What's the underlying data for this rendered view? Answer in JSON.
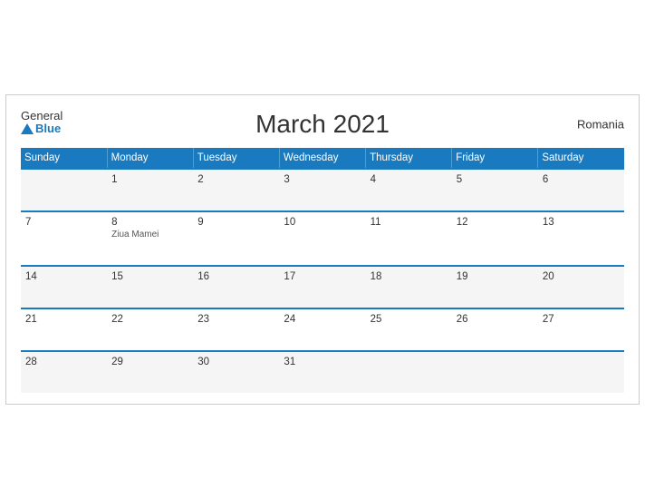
{
  "header": {
    "title": "March 2021",
    "country": "Romania",
    "logo_general": "General",
    "logo_blue": "Blue"
  },
  "weekdays": [
    "Sunday",
    "Monday",
    "Tuesday",
    "Wednesday",
    "Thursday",
    "Friday",
    "Saturday"
  ],
  "weeks": [
    [
      {
        "day": "",
        "event": ""
      },
      {
        "day": "1",
        "event": ""
      },
      {
        "day": "2",
        "event": ""
      },
      {
        "day": "3",
        "event": ""
      },
      {
        "day": "4",
        "event": ""
      },
      {
        "day": "5",
        "event": ""
      },
      {
        "day": "6",
        "event": ""
      }
    ],
    [
      {
        "day": "7",
        "event": ""
      },
      {
        "day": "8",
        "event": "Ziua Mamei"
      },
      {
        "day": "9",
        "event": ""
      },
      {
        "day": "10",
        "event": ""
      },
      {
        "day": "11",
        "event": ""
      },
      {
        "day": "12",
        "event": ""
      },
      {
        "day": "13",
        "event": ""
      }
    ],
    [
      {
        "day": "14",
        "event": ""
      },
      {
        "day": "15",
        "event": ""
      },
      {
        "day": "16",
        "event": ""
      },
      {
        "day": "17",
        "event": ""
      },
      {
        "day": "18",
        "event": ""
      },
      {
        "day": "19",
        "event": ""
      },
      {
        "day": "20",
        "event": ""
      }
    ],
    [
      {
        "day": "21",
        "event": ""
      },
      {
        "day": "22",
        "event": ""
      },
      {
        "day": "23",
        "event": ""
      },
      {
        "day": "24",
        "event": ""
      },
      {
        "day": "25",
        "event": ""
      },
      {
        "day": "26",
        "event": ""
      },
      {
        "day": "27",
        "event": ""
      }
    ],
    [
      {
        "day": "28",
        "event": ""
      },
      {
        "day": "29",
        "event": ""
      },
      {
        "day": "30",
        "event": ""
      },
      {
        "day": "31",
        "event": ""
      },
      {
        "day": "",
        "event": ""
      },
      {
        "day": "",
        "event": ""
      },
      {
        "day": "",
        "event": ""
      }
    ]
  ]
}
